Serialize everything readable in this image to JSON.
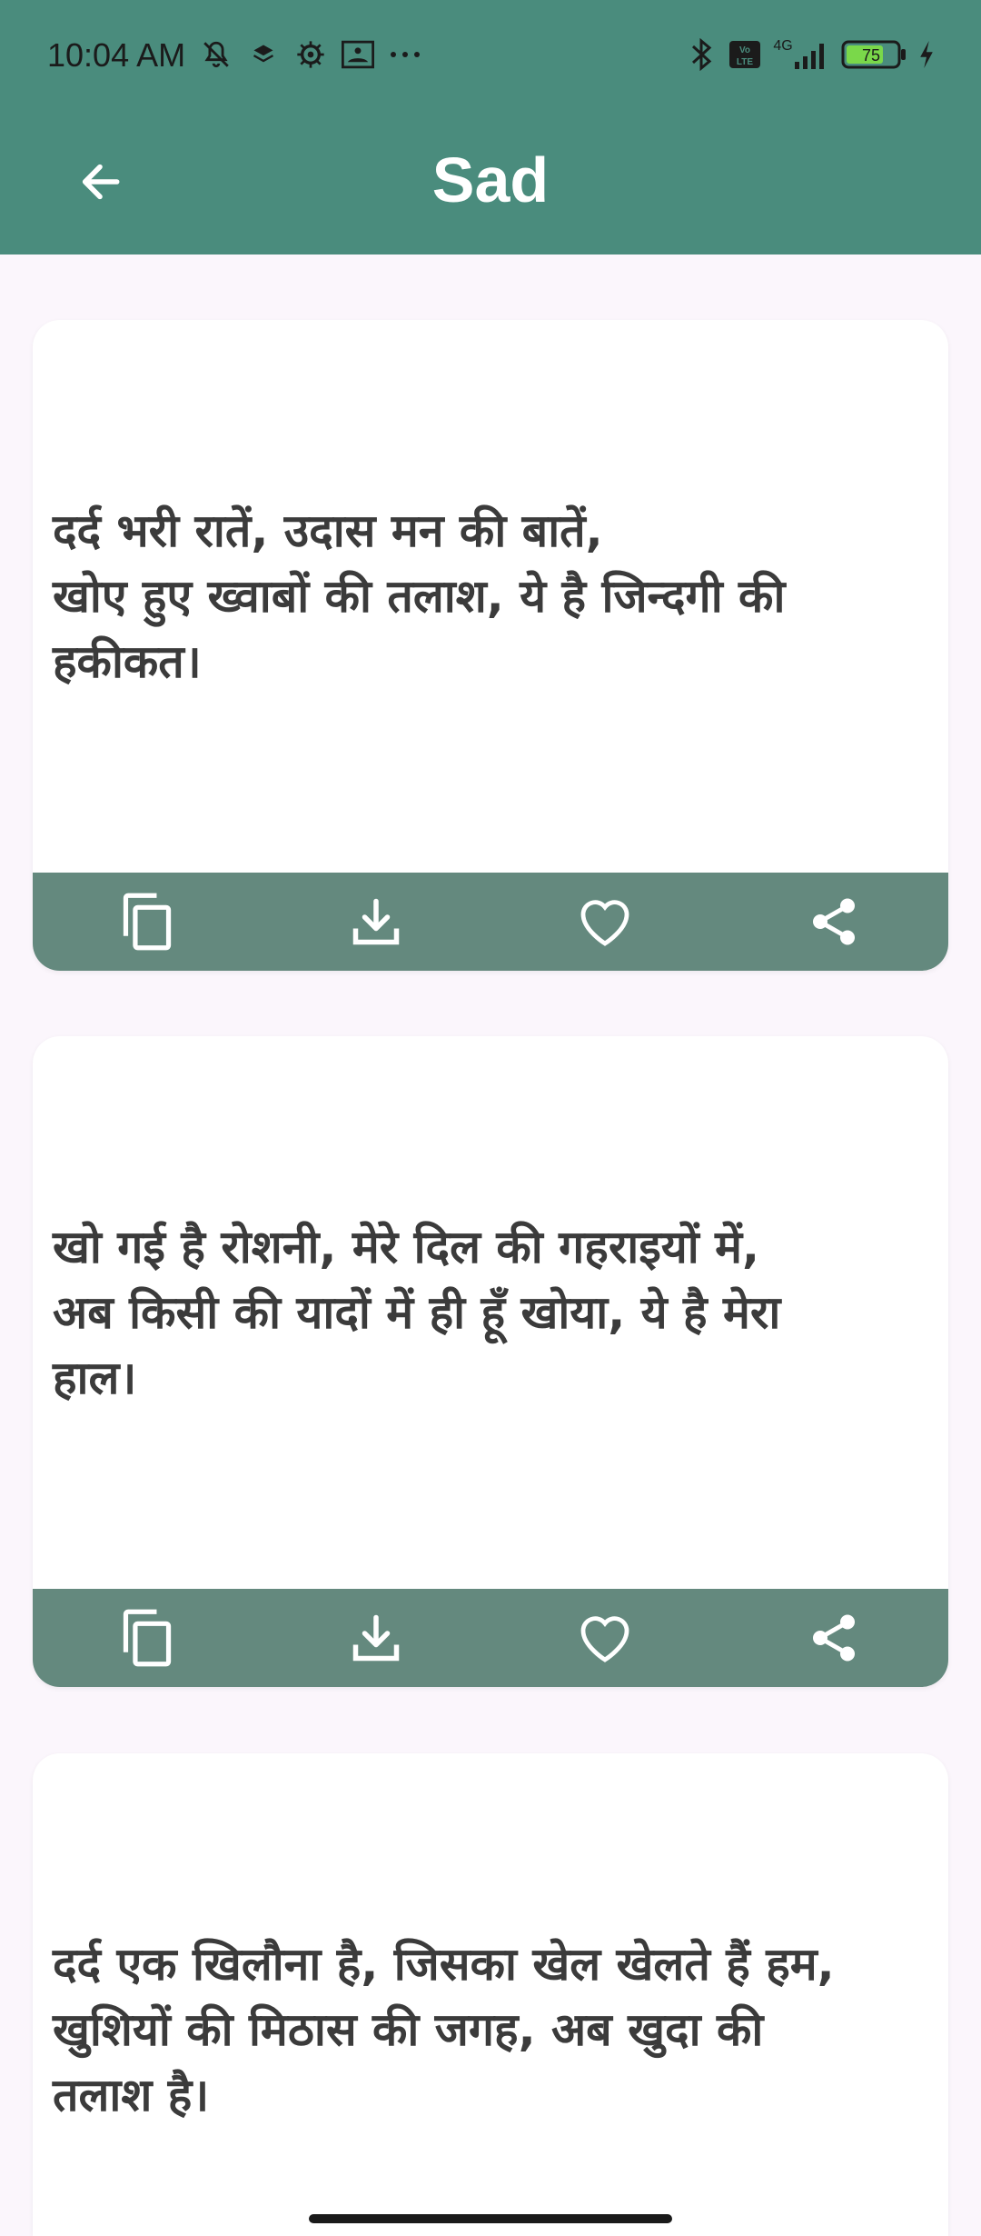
{
  "status_bar": {
    "time": "10:04 AM",
    "left_icons": [
      "mute-icon",
      "layers-icon",
      "settings-icon",
      "gallery-icon",
      "more-dots-icon"
    ],
    "right_icons": [
      "bluetooth-icon",
      "volte-icon",
      "signal-4g-icon",
      "battery-icon",
      "charging-icon"
    ],
    "network": "4G",
    "battery": "75"
  },
  "app_bar": {
    "title": "Sad",
    "back_icon": "arrow-left-icon"
  },
  "quotes": [
    {
      "text": "दर्द भरी रातें, उदास मन की बातें,\nखोए हुए ख्वाबों की तलाश, ये है जिन्दगी की\nहकीकत।"
    },
    {
      "text": "खो गई है रोशनी, मेरे दिल की गहराइयों में,\nअब किसी की यादों में ही हूँ खोया, ये है मेरा\nहाल।"
    },
    {
      "text": "दर्द एक खिलौना है, जिसका खेल खेलते हैं हम,\nखुशियों की मिठास की जगह, अब खुदा की\nतलाश है।"
    }
  ],
  "card_actions": [
    "copy-icon",
    "download-icon",
    "favorite-icon",
    "share-icon"
  ],
  "colors": {
    "app_bar": "#4a8c7d",
    "action_bar": "#64897e",
    "background": "#fbf6fc",
    "card": "#ffffff",
    "quote_text": "#3b3b3b"
  }
}
